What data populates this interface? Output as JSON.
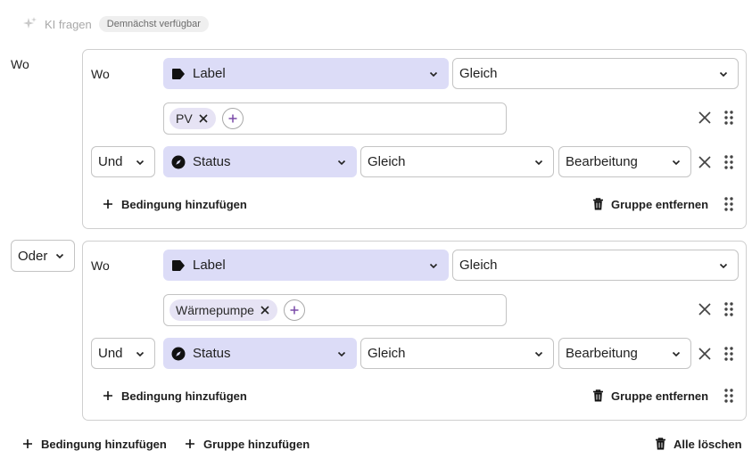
{
  "ai": {
    "label": "KI fragen",
    "badge": "Demnächst verfügbar"
  },
  "root_label": "Wo",
  "groups": [
    {
      "connector": null,
      "row1": {
        "label": "Wo",
        "field": "Label",
        "operator": "Gleich",
        "tags": [
          "PV"
        ]
      },
      "row2": {
        "connector": "Und",
        "field": "Status",
        "operator": "Gleich",
        "value": "Bearbeitung"
      },
      "add_condition": "Bedingung hinzufügen",
      "remove_group": "Gruppe entfernen"
    },
    {
      "connector": "Oder",
      "row1": {
        "label": "Wo",
        "field": "Label",
        "operator": "Gleich",
        "tags": [
          "Wärmepumpe"
        ]
      },
      "row2": {
        "connector": "Und",
        "field": "Status",
        "operator": "Gleich",
        "value": "Bearbeitung"
      },
      "add_condition": "Bedingung hinzufügen",
      "remove_group": "Gruppe entfernen"
    }
  ],
  "footer": {
    "add_condition": "Bedingung hinzufügen",
    "add_group": "Gruppe hinzufügen",
    "clear_all": "Alle löschen"
  },
  "colors": {
    "field_bg": "#dcdcf7",
    "tag_bg": "#e6e3f4",
    "add_tag": "#7a4aa8"
  }
}
